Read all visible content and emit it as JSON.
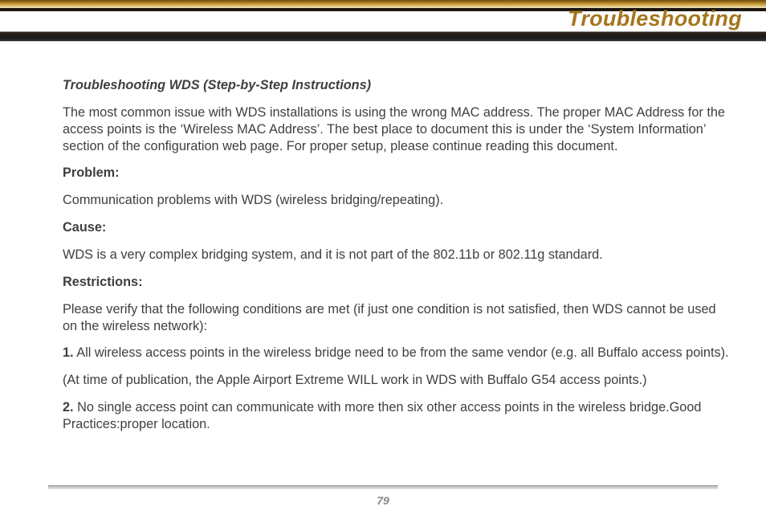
{
  "header": {
    "title": "Troubleshooting"
  },
  "section": {
    "heading": "Troubleshooting WDS (Step-by-Step Instructions)",
    "intro": "The most common issue with WDS installations is using the wrong MAC address. The proper MAC Address for the access points is the ‘Wireless MAC Address’. The best place to document this is under the ‘System Information’ section of the configuration web page. For proper setup, please continue reading this document.",
    "problem_label": "Problem:",
    "problem_text": "Communication problems with WDS (wireless bridging/repeating).",
    "cause_label": "Cause:",
    "cause_text": "WDS is a very complex bridging system, and it is not part of the 802.11b or 802.11g standard.",
    "restrictions_label": "Restrictions:",
    "restrictions_text": "Please verify that the following conditions are met (if just one condition is not satisfied, then WDS cannot be used on the wireless network):",
    "item1_num": "1.",
    "item1_text": " All wireless access points in the wireless bridge need to be from the same vendor (e.g. all Buffalo access points).",
    "item1_note": "(At time of publication, the Apple Airport Extreme WILL work in WDS with Buffalo G54 access points.)",
    "item2_num": "2.",
    "item2_text": "  No single access point can communicate with more then six other access points in the wireless bridge.Good Practices:proper location."
  },
  "footer": {
    "page_number": "79"
  }
}
